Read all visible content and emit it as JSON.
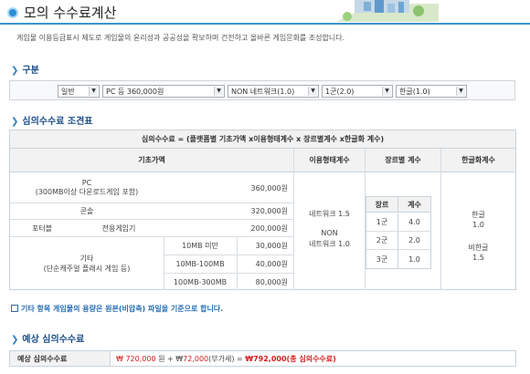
{
  "header": {
    "title": "모의 수수료계산",
    "intro": "게임물 이용등급표시 제도로 게임물의 윤리성과 공공성을 확보하며 건전하고 올바른 게임문화를 조성합니다."
  },
  "classification": {
    "title": "구분",
    "selects": [
      {
        "value": "일반"
      },
      {
        "value": "PC 등 360,000원"
      },
      {
        "value": "NON 네트워크(1.0)"
      },
      {
        "value": "1군(2.0)"
      },
      {
        "value": "한글(1.0)"
      }
    ]
  },
  "fee_table": {
    "title": "심의수수료 조견표",
    "formula": "심의수수료 = (플랫폼별 기초가액 x이용형태계수 x 장르별계수 x한글화 계수)",
    "headers": {
      "base": "기초가액",
      "usage": "이용형태계수",
      "genre": "장르별 계수",
      "korean": "한글화계수"
    },
    "pc_label": "PC",
    "pc_sub": "(300MB이상 다운로드게임 포함)",
    "pc_value": "360,000원",
    "console_label": "콘솔",
    "console_value": "320,000원",
    "portable_label": "포터블",
    "portable_sub": "전용게임기",
    "portable_value": "200,000원",
    "etc_label": "기타",
    "etc_sub": "(단순캐주얼 플래시 게임 등)",
    "etc_rows": [
      {
        "size": "10MB 미만",
        "value": "30,000원"
      },
      {
        "size": "10MB-100MB",
        "value": "40,000원"
      },
      {
        "size": "100MB-300MB",
        "value": "80,000원"
      }
    ],
    "usage_network": "네트워크 1.5",
    "usage_non1": "NON",
    "usage_non2": "네트워크 1.0",
    "genre_headers": {
      "genre": "장르",
      "coef": "계수"
    },
    "genre_rows": [
      {
        "genre": "1군",
        "coef": "4.0"
      },
      {
        "genre": "2군",
        "coef": "2.0"
      },
      {
        "genre": "3군",
        "coef": "1.0"
      }
    ],
    "korean_a": "한글",
    "korean_a_val": "1.0",
    "korean_b": "비한글",
    "korean_b_val": "1.5"
  },
  "note": "기타 항목 게임물의 용량은 원본(비압축) 파일을 기준으로 합니다.",
  "estimate": {
    "title": "예상 심의수수료",
    "label": "예상 심의수수료",
    "fee": "₩ 720,000",
    "mid": " 원 + ₩",
    "vat": "72,000",
    "vat_note": "(부가세) = ",
    "total": "₩792,000(총 심의수수료)"
  }
}
